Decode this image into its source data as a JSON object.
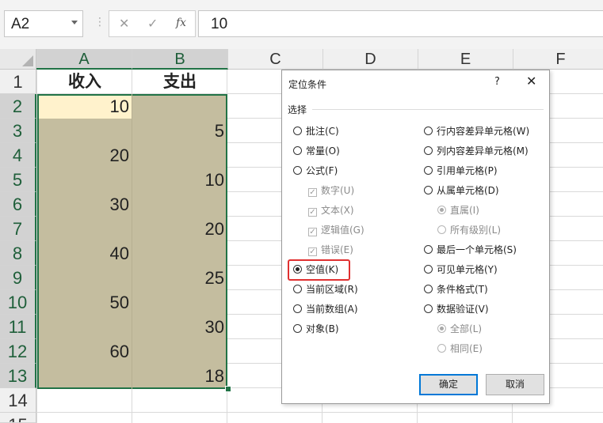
{
  "formula_bar": {
    "name_box": "A2",
    "cancel_icon": "✕",
    "enter_icon": "✓",
    "fx_label": "fx",
    "formula": "10"
  },
  "columns": [
    "A",
    "B",
    "C",
    "D",
    "E",
    "F"
  ],
  "rows": [
    "1",
    "2",
    "3",
    "4",
    "5",
    "6",
    "7",
    "8",
    "9",
    "10",
    "11",
    "12",
    "13",
    "14",
    "15"
  ],
  "cells": {
    "A1": "收入",
    "B1": "支出",
    "A2": "10",
    "B3": "5",
    "A4": "20",
    "B5": "10",
    "A6": "30",
    "B7": "20",
    "A8": "40",
    "B9": "25",
    "A10": "50",
    "B11": "30",
    "A12": "60",
    "B13": "18"
  },
  "colors": {
    "selection_fill": "#c4bd9f",
    "selection_border": "#217346",
    "active_cell_fill": "#fff2cc",
    "highlight_box": "#e03030"
  },
  "dialog": {
    "title": "定位条件",
    "help": "?",
    "close": "✕",
    "group_label": "选择",
    "left_options": [
      {
        "label": "批注(C)",
        "checked": false,
        "disabled": false
      },
      {
        "label": "常量(O)",
        "checked": false,
        "disabled": false
      },
      {
        "label": "公式(F)",
        "checked": false,
        "disabled": false
      },
      {
        "label": "数字(U)",
        "kind": "checkbox",
        "disabled": true
      },
      {
        "label": "文本(X)",
        "kind": "checkbox",
        "disabled": true
      },
      {
        "label": "逻辑值(G)",
        "kind": "checkbox",
        "disabled": true
      },
      {
        "label": "错误(E)",
        "kind": "checkbox",
        "disabled": true
      },
      {
        "label": "空值(K)",
        "checked": true,
        "disabled": false
      },
      {
        "label": "当前区域(R)",
        "checked": false,
        "disabled": false
      },
      {
        "label": "当前数组(A)",
        "checked": false,
        "disabled": false
      },
      {
        "label": "对象(B)",
        "checked": false,
        "disabled": false
      }
    ],
    "right_options": [
      {
        "label": "行内容差异单元格(W)",
        "checked": false,
        "disabled": false
      },
      {
        "label": "列内容差异单元格(M)",
        "checked": false,
        "disabled": false
      },
      {
        "label": "引用单元格(P)",
        "checked": false,
        "disabled": false
      },
      {
        "label": "从属单元格(D)",
        "checked": false,
        "disabled": false
      },
      {
        "label": "直属(I)",
        "checked": true,
        "disabled": true
      },
      {
        "label": "所有级别(L)",
        "checked": false,
        "disabled": true
      },
      {
        "label": "最后一个单元格(S)",
        "checked": false,
        "disabled": false
      },
      {
        "label": "可见单元格(Y)",
        "checked": false,
        "disabled": false
      },
      {
        "label": "条件格式(T)",
        "checked": false,
        "disabled": false
      },
      {
        "label": "数据验证(V)",
        "checked": false,
        "disabled": false
      },
      {
        "label": "全部(L)",
        "checked": true,
        "disabled": true
      },
      {
        "label": "相同(E)",
        "checked": false,
        "disabled": true
      }
    ],
    "ok_label": "确定",
    "cancel_label": "取消"
  }
}
